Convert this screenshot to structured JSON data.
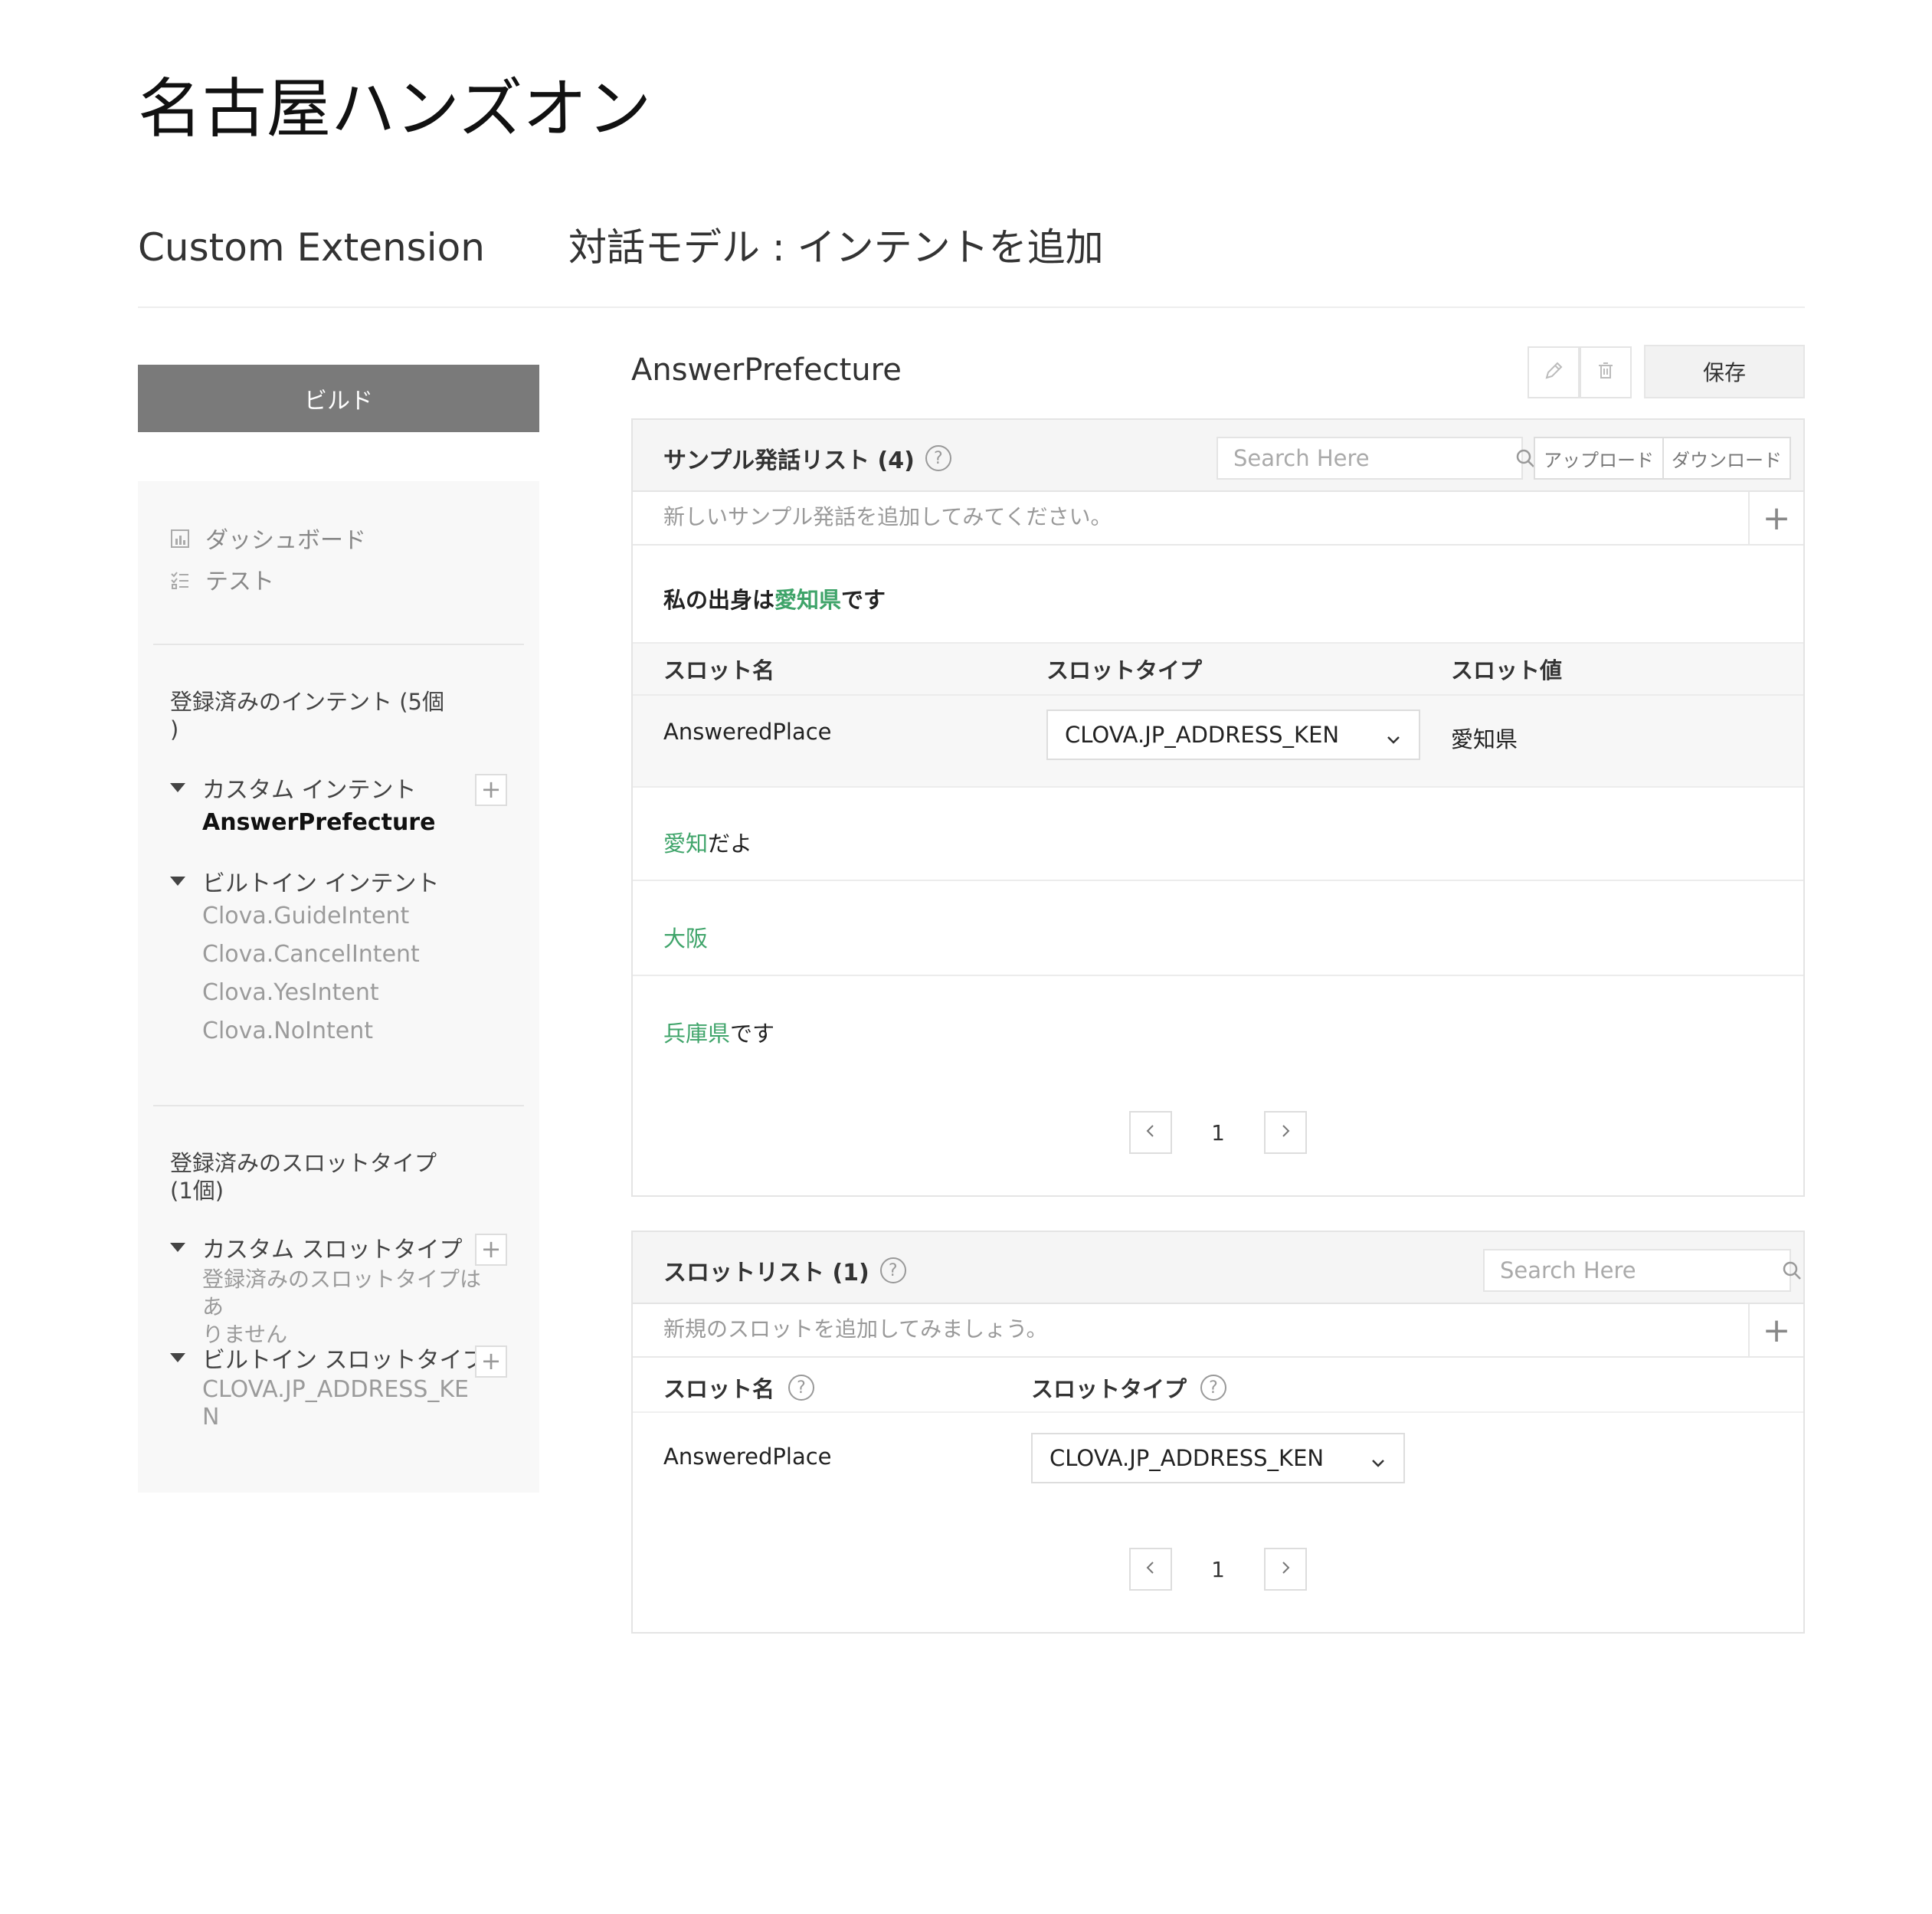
{
  "app": {
    "title": "名古屋ハンズオン"
  },
  "header": {
    "section": "Custom Extension",
    "subtitle": "対話モデル : インテントを追加"
  },
  "sidebar": {
    "build_label": "ビルド",
    "nav": [
      {
        "label": "ダッシュボード",
        "icon": "chart-icon"
      },
      {
        "label": "テスト",
        "icon": "checklist-icon"
      }
    ],
    "intents_heading_line1": "登録済みのインテント (5個",
    "intents_heading_line2": ")",
    "custom_intents_label": "カスタム インテント",
    "custom_intents": [
      "AnswerPrefecture"
    ],
    "builtin_intents_label": "ビルトイン インテント",
    "builtin_intents": [
      "Clova.GuideIntent",
      "Clova.CancelIntent",
      "Clova.YesIntent",
      "Clova.NoIntent"
    ],
    "slot_types_heading_line1": "登録済みのスロットタイプ",
    "slot_types_heading_line2": "(1個)",
    "custom_slot_types_label": "カスタム スロットタイプ",
    "custom_slot_types_empty_line1": "登録済みのスロットタイプはあ",
    "custom_slot_types_empty_line2": "りません",
    "builtin_slot_types_label": "ビルトイン スロットタイプ",
    "builtin_slot_types_line1": "CLOVA.JP_ADDRESS_KE",
    "builtin_slot_types_line2": "N"
  },
  "main": {
    "intent_name": "AnswerPrefecture",
    "save_label": "保存",
    "utterances_panel": {
      "title": "サンプル発話リスト (4)",
      "search_placeholder": "Search Here",
      "upload_label": "アップロード",
      "download_label": "ダウンロード",
      "add_placeholder": "新しいサンプル発話を追加してみてください。",
      "utterances": [
        {
          "pre": "私の出身は",
          "slot": "愛知県",
          "post": "です"
        },
        {
          "pre": "",
          "slot": "愛知",
          "post": "だよ"
        },
        {
          "pre": "",
          "slot": "大阪",
          "post": ""
        },
        {
          "pre": "",
          "slot": "兵庫県",
          "post": "です"
        }
      ],
      "slot_table": {
        "headers": [
          "スロット名",
          "スロットタイプ",
          "スロット値"
        ],
        "row": {
          "name": "AnsweredPlace",
          "type": "CLOVA.JP_ADDRESS_KEN",
          "value": "愛知県"
        }
      },
      "page": "1"
    },
    "slots_panel": {
      "title": "スロットリスト (1)",
      "search_placeholder": "Search Here",
      "add_placeholder": "新規のスロットを追加してみましょう。",
      "headers": [
        "スロット名",
        "スロットタイプ"
      ],
      "row": {
        "name": "AnsweredPlace",
        "type": "CLOVA.JP_ADDRESS_KEN"
      },
      "page": "1"
    }
  },
  "colors": {
    "accent_green": "#3fa46a",
    "build_button": "#7a7a7a"
  }
}
